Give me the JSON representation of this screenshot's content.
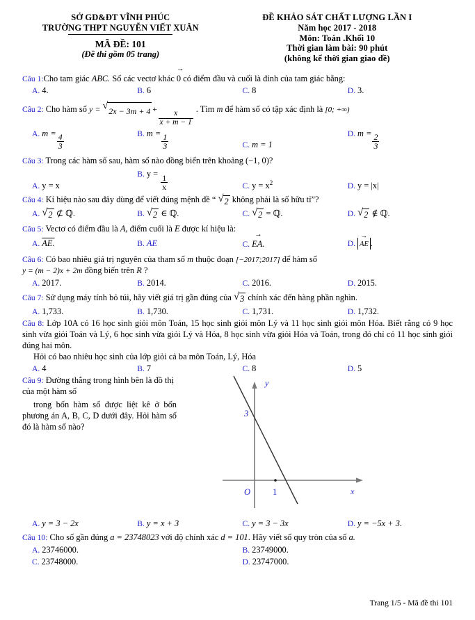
{
  "header": {
    "left": {
      "line1": "SỞ GD&ĐT VĨNH PHÚC",
      "line2": "TRƯỜNG THPT NGUYỄN VIẾT XUÂN",
      "code": "MÃ ĐỀ: 101",
      "pages": "(Đề thi gồm 05 trang)"
    },
    "right": {
      "line1": "ĐỀ KHẢO SÁT CHẤT LƯỢNG LẦN I",
      "line2": "Năm học 2017 - 2018",
      "line3": "Môn: Toán .Khối 10",
      "line4": "Thời gian làm bài: 90 phút",
      "line5": "(không kể thời gian giao đề)"
    }
  },
  "questions": [
    {
      "label": "Câu 1:",
      "text_a": "Cho tam giác ",
      "text_b": "ABC.",
      "text_c": " Số các vectơ khác ",
      "text_d": "0",
      "text_e": " có điểm đầu và cuối là đỉnh của tam giác bằng:",
      "options": [
        {
          "letter": "A.",
          "text": "4."
        },
        {
          "letter": "B.",
          "text": "6"
        },
        {
          "letter": "C.",
          "text": "8"
        },
        {
          "letter": "D.",
          "text": "3."
        }
      ]
    },
    {
      "label": "Câu 2:",
      "lead": "Cho hàm số",
      "formula": {
        "y": "y =",
        "radicand": "2x − 3m + 4",
        "plus": "+",
        "frac_num": "x",
        "frac_den": "x + m − 1"
      },
      "mid": ". Tìm ",
      "m": "m",
      "tail": " để hàm số có tập xác định là ",
      "domain": "[0; +∞)",
      "options": [
        {
          "letter": "A.",
          "var": "m =",
          "num": "4",
          "den": "3"
        },
        {
          "letter": "B.",
          "var": "m =",
          "num": "1",
          "den": "3"
        },
        {
          "letter": "C.",
          "text": "m = 1"
        },
        {
          "letter": "D.",
          "var": "m =",
          "num": "2",
          "den": "3"
        }
      ]
    },
    {
      "label": "Câu 3:",
      "text": "Trong các hàm số sau, hàm số nào đồng biến trên khoảng (−1, 0)?",
      "options": [
        {
          "letter": "A.",
          "text": "y = x"
        },
        {
          "letter": "B.",
          "text": "y =",
          "num": "1",
          "den": "x"
        },
        {
          "letter": "C.",
          "text": "y = x",
          "sup": "2"
        },
        {
          "letter": "D.",
          "text": "y = |x|"
        }
      ]
    },
    {
      "label": "Câu 4:",
      "text_a": "Kí hiệu nào sau đây dùng để viết đúng mệnh đề “ ",
      "sqrt2": "2",
      "text_b": " không phải là số hữu tỉ”?",
      "options": [
        {
          "letter": "A.",
          "rel": "⊄ ℚ."
        },
        {
          "letter": "B.",
          "rel": "∈ ℚ."
        },
        {
          "letter": "C.",
          "rel": "= ℚ."
        },
        {
          "letter": "D.",
          "rel": "∉ ℚ."
        }
      ]
    },
    {
      "label": "Câu 5:",
      "text_a": "Vectơ có điểm đầu là ",
      "A": "A",
      "text_b": ", điểm cuối là ",
      "E": "E",
      "text_c": " được kí hiệu là:",
      "options": [
        {
          "letter": "A.",
          "text": "AE.",
          "style": "overline"
        },
        {
          "letter": "B.",
          "text": "AE",
          "style": "plain-blue"
        },
        {
          "letter": "C.",
          "text": "EA.",
          "style": "vector"
        },
        {
          "letter": "D.",
          "text": "AE",
          "style": "abs-vector"
        }
      ]
    },
    {
      "label": "Câu 6:",
      "text_a": "Có bao nhiêu giá trị nguyên của tham số ",
      "m": "m",
      "text_b": " thuộc đoạn ",
      "interval": "[−2017;2017]",
      "text_c": " để hàm số ",
      "formula": "y = (m − 2)x + 2m",
      "text_d": " đồng biến trên ",
      "R": "R",
      "text_e": " ?",
      "options": [
        {
          "letter": "A.",
          "text": "2017."
        },
        {
          "letter": "B.",
          "text": "2014."
        },
        {
          "letter": "C.",
          "text": "2016."
        },
        {
          "letter": "D.",
          "text": "2015."
        }
      ]
    },
    {
      "label": "Câu 7:",
      "text_a": "Sử dụng máy tính bỏ túi, hãy viết giá trị gần đúng của ",
      "sqrt3": "3",
      "text_b": " chính xác đến hàng phần nghìn.",
      "options": [
        {
          "letter": "A.",
          "text": "1,733."
        },
        {
          "letter": "B.",
          "text": "1,730."
        },
        {
          "letter": "C.",
          "text": "1,731."
        },
        {
          "letter": "D.",
          "text": "1,732."
        }
      ]
    },
    {
      "label": "Câu 8:",
      "text": "Lớp 10A có 16 học sinh giỏi môn Toán, 15 học sinh giỏi môn Lý và 11 học sinh giỏi môn Hóa. Biết rằng có 9 học sinh vừa giỏi Toán và Lý, 6 học sinh vừa giỏi Lý và Hóa, 8 học sinh vừa giỏi Hóa và Toán, trong đó chỉ có 11 học sinh giỏi đúng hai môn.",
      "text2": "Hỏi có bao nhiêu học sinh của lớp giỏi cả ba môn Toán, Lý, Hóa",
      "options": [
        {
          "letter": "A.",
          "text": "4"
        },
        {
          "letter": "B.",
          "text": "7"
        },
        {
          "letter": "C.",
          "text": "8"
        },
        {
          "letter": "D.",
          "text": "5"
        }
      ]
    },
    {
      "label": "Câu 9:",
      "text_line1": "Đường thẳng trong hình bên là đồ thị",
      "text_line2": "của một hàm số",
      "text_line3": "trong bốn hàm số được liệt kê ở bốn phương án A, B, C, D dưới đây. Hỏi hàm số đó là hàm số nào?",
      "options": [
        {
          "letter": "A.",
          "text": "y = 3 − 2x"
        },
        {
          "letter": "B.",
          "text": "y = x + 3"
        },
        {
          "letter": "C.",
          "text": "y = 3 − 3x"
        },
        {
          "letter": "D.",
          "text": "y = −5x + 3"
        }
      ]
    },
    {
      "label": "Câu 10:",
      "text_a": "Cho số gần đúng ",
      "a": "a = 23748023",
      "text_b": " với độ chính xác ",
      "d": "d = 101",
      "text_c": ". Hãy viết số quy tròn của số ",
      "avar": "a.",
      "options": [
        {
          "letter": "A.",
          "text": "23746000."
        },
        {
          "letter": "B.",
          "text": "23749000."
        },
        {
          "letter": "C.",
          "text": "23748000."
        },
        {
          "letter": "D.",
          "text": "23747000."
        }
      ]
    }
  ],
  "figure": {
    "y_axis_label": "y",
    "x_axis_label": "x",
    "origin_label": "O",
    "y_intercept_label": "3",
    "x_tick_label": "1"
  },
  "chart_data": {
    "type": "line",
    "title": "",
    "xlabel": "x",
    "ylabel": "y",
    "series": [
      {
        "name": "y = 3 - 2x",
        "points": [
          [
            -0.5,
            4
          ],
          [
            0,
            3
          ],
          [
            1,
            1
          ],
          [
            1.5,
            0
          ],
          [
            2.3,
            -1.6
          ]
        ]
      }
    ],
    "annotations": [
      "y-intercept at 3",
      "x-intercept at 1.5"
    ],
    "xlim": [
      -1,
      3
    ],
    "ylim": [
      -2,
      4.5
    ],
    "grid": false,
    "ticks": {
      "x": [
        0,
        1
      ],
      "y": [
        3
      ]
    }
  },
  "footer": {
    "text": "Trang 1/5 - Mã đề thi 101"
  },
  "colors": {
    "label_blue": "#2222cc",
    "text_black": "#000000",
    "axis_gray": "#808080",
    "line_dark": "#404040"
  }
}
